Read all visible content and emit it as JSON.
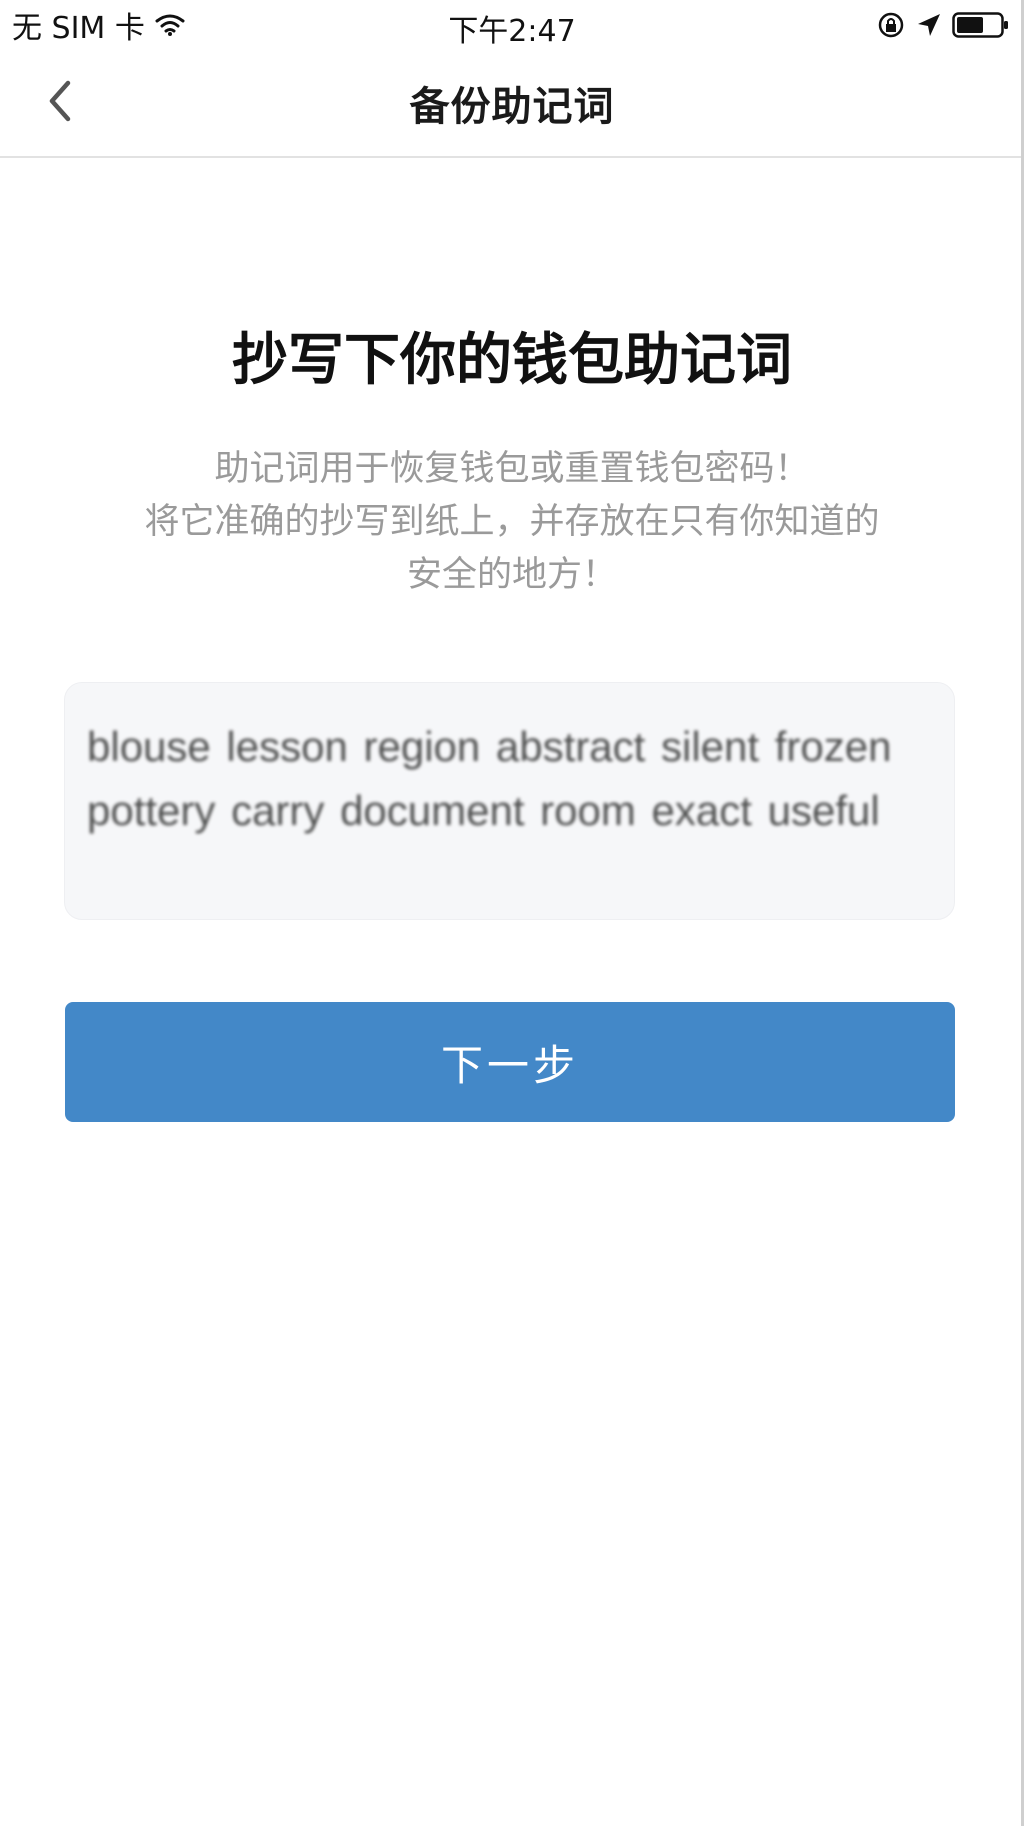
{
  "status_bar": {
    "carrier": "无 SIM 卡",
    "time": "下午2:47",
    "icons": [
      "wifi-icon",
      "lock-rotation-icon",
      "location-icon",
      "battery-icon"
    ]
  },
  "nav": {
    "back_icon": "chevron-left-icon",
    "title": "备份助记词"
  },
  "content": {
    "heading": "抄写下你的钱包助记词",
    "description_lines": [
      "助记词用于恢复钱包或重置钱包密码！",
      "将它准确的抄写到纸上，并存放在只有你知道的",
      "安全的地方！"
    ],
    "mnemonic": "blouse lesson region abstract silent frozen pottery carry document room exact useful",
    "next_button": "下一步"
  },
  "colors": {
    "accent": "#4388c8",
    "mnemonic_bg": "#f6f7f9",
    "description_text": "#9a9a9a"
  }
}
